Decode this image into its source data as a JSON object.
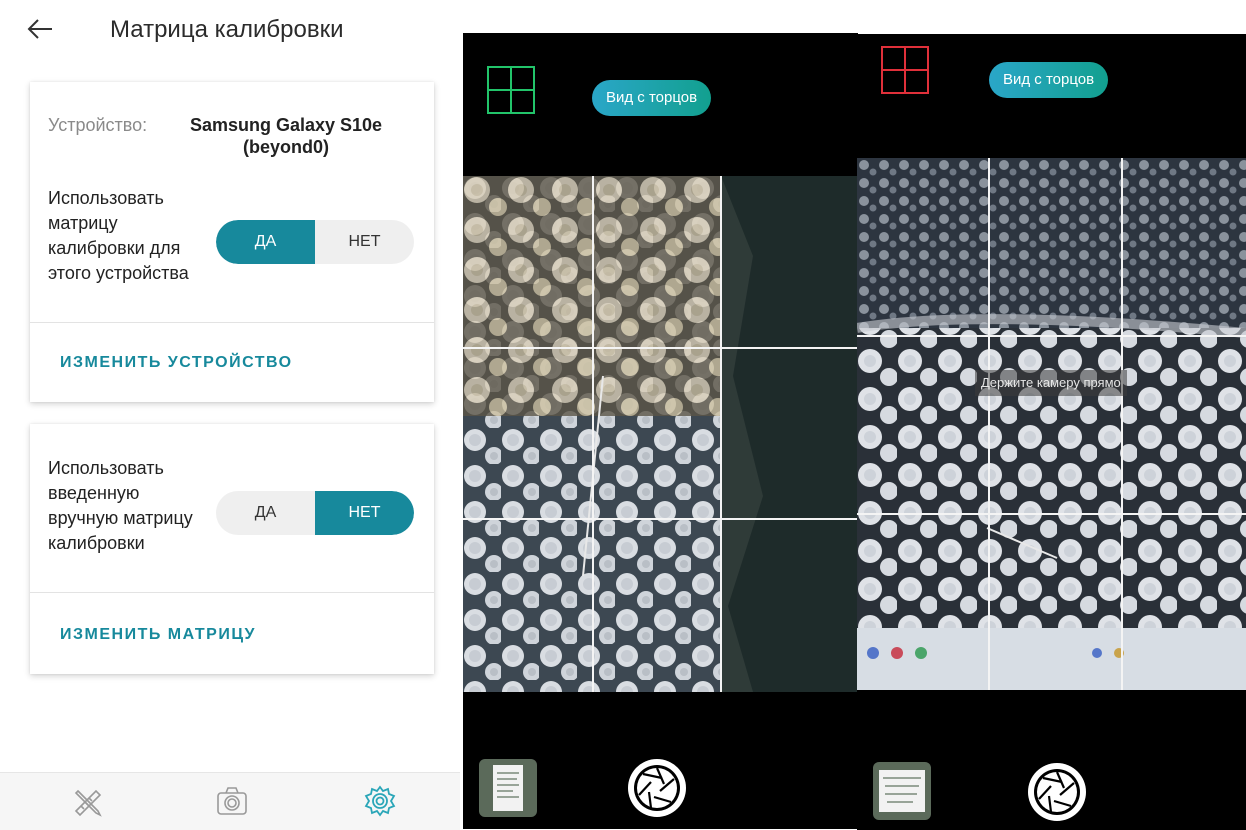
{
  "header": {
    "back_icon": "arrow-back-icon",
    "title": "Матрица калибровки"
  },
  "card1": {
    "device_label": "Устройство:",
    "device_name": "Samsung Galaxy S10e (beyond0)",
    "toggle_label": "Использовать матрицу калибровки для этого устройства",
    "yes": "ДА",
    "no": "НЕТ",
    "selected": "ДА",
    "action": "ИЗМЕНИТЬ УСТРОЙСТВО"
  },
  "card2": {
    "toggle_label": "Использовать введенную вручную матрицу калибровки",
    "yes": "ДА",
    "no": "НЕТ",
    "selected": "НЕТ",
    "action": "ИЗМЕНИТЬ МАТРИЦУ"
  },
  "bottom_nav": {
    "items": [
      {
        "icon": "ruler-pencil-icon"
      },
      {
        "icon": "camera-icon"
      },
      {
        "icon": "gear-icon",
        "active": true
      }
    ]
  },
  "camera_left": {
    "grid_icon": "grid-icon",
    "grid_color": "#22c46a",
    "end_view_button": "Вид с торцов"
  },
  "camera_right": {
    "grid_icon": "grid-icon",
    "grid_color": "#e0303a",
    "end_view_button": "Вид с торцов",
    "hint": "Держите камеру прямо"
  },
  "colors": {
    "accent": "#17899c",
    "active_nav": "#2aa6b8"
  }
}
